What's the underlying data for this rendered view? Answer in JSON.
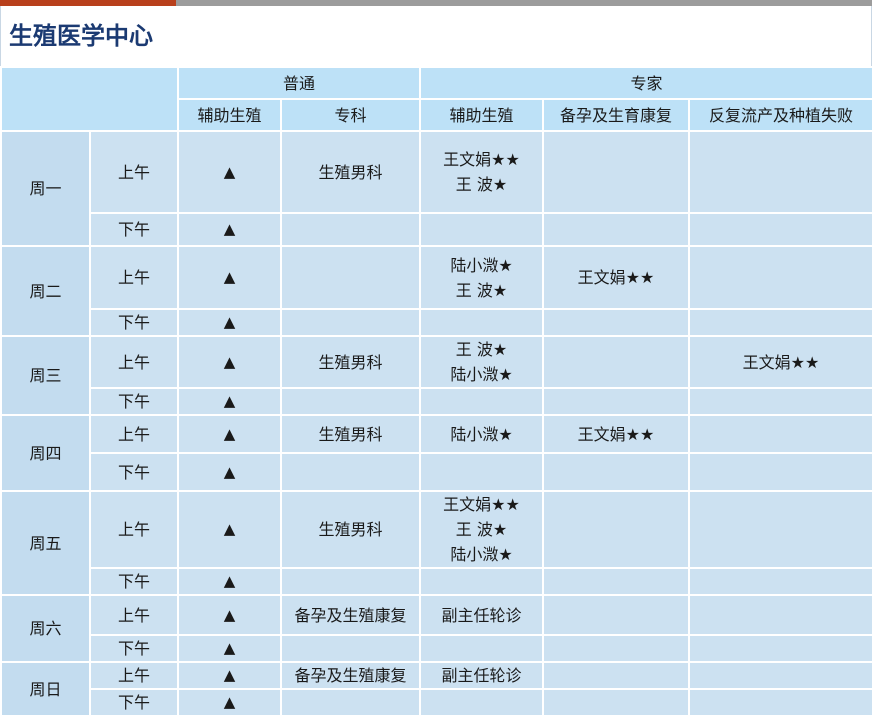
{
  "page_title": "生殖医学中心",
  "headers": {
    "group_general": "普通",
    "group_expert": "专家",
    "sub": [
      "辅助生殖",
      "专科",
      "辅助生殖",
      "备孕及生育康复",
      "反复流产及种植失败"
    ]
  },
  "days": [
    {
      "day": "周一",
      "rows": [
        {
          "period": "上午",
          "general_art": "▲",
          "specialty": "生殖男科",
          "expert_art": [
            "王文娟★★",
            "王  波★"
          ],
          "expert_prep": [],
          "expert_recurrent": []
        },
        {
          "period": "下午",
          "general_art": "▲",
          "specialty": "",
          "expert_art": [],
          "expert_prep": [],
          "expert_recurrent": []
        }
      ]
    },
    {
      "day": "周二",
      "rows": [
        {
          "period": "上午",
          "general_art": "▲",
          "specialty": "",
          "expert_art": [
            "陆小溦★",
            "王  波★"
          ],
          "expert_prep": [
            "王文娟★★"
          ],
          "expert_recurrent": []
        },
        {
          "period": "下午",
          "general_art": "▲",
          "specialty": "",
          "expert_art": [],
          "expert_prep": [],
          "expert_recurrent": []
        }
      ]
    },
    {
      "day": "周三",
      "rows": [
        {
          "period": "上午",
          "general_art": "▲",
          "specialty": "生殖男科",
          "expert_art": [
            "王  波★",
            "陆小溦★"
          ],
          "expert_prep": [],
          "expert_recurrent": [
            "王文娟★★"
          ]
        },
        {
          "period": "下午",
          "general_art": "▲",
          "specialty": "",
          "expert_art": [],
          "expert_prep": [],
          "expert_recurrent": []
        }
      ]
    },
    {
      "day": "周四",
      "rows": [
        {
          "period": "上午",
          "general_art": "▲",
          "specialty": "生殖男科",
          "expert_art": [
            "陆小溦★"
          ],
          "expert_prep": [
            "王文娟★★"
          ],
          "expert_recurrent": []
        },
        {
          "period": "下午",
          "general_art": "▲",
          "specialty": "",
          "expert_art": [],
          "expert_prep": [],
          "expert_recurrent": []
        }
      ]
    },
    {
      "day": "周五",
      "rows": [
        {
          "period": "上午",
          "general_art": "▲",
          "specialty": "生殖男科",
          "expert_art": [
            "王文娟★★",
            "王  波★",
            "陆小溦★"
          ],
          "expert_prep": [],
          "expert_recurrent": []
        },
        {
          "period": "下午",
          "general_art": "▲",
          "specialty": "",
          "expert_art": [],
          "expert_prep": [],
          "expert_recurrent": []
        }
      ]
    },
    {
      "day": "周六",
      "rows": [
        {
          "period": "上午",
          "general_art": "▲",
          "specialty": "备孕及生殖康复",
          "expert_art": [
            "副主任轮诊"
          ],
          "expert_prep": [],
          "expert_recurrent": []
        },
        {
          "period": "下午",
          "general_art": "▲",
          "specialty": "",
          "expert_art": [],
          "expert_prep": [],
          "expert_recurrent": []
        }
      ]
    },
    {
      "day": "周日",
      "rows": [
        {
          "period": "上午",
          "general_art": "▲",
          "specialty": "备孕及生殖康复",
          "expert_art": [
            "副主任轮诊"
          ],
          "expert_prep": [],
          "expert_recurrent": []
        },
        {
          "period": "下午",
          "general_art": "▲",
          "specialty": "",
          "expert_art": [],
          "expert_prep": [],
          "expert_recurrent": []
        }
      ]
    }
  ],
  "colors": {
    "title": "#1b3a72",
    "header_bg": "#bde1f7",
    "cell_bg": "#cce1f1",
    "accent_bar": "#b8401c",
    "gray_bar": "#9c9c9c"
  }
}
